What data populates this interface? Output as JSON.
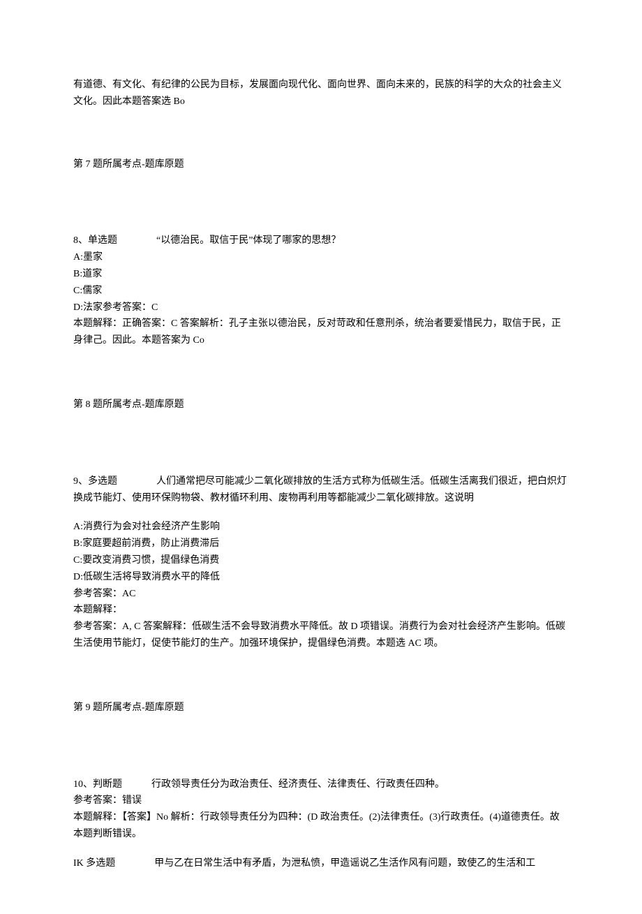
{
  "frag_top": "有道德、有文化、有纪律的公民为目标，发展面向现代化、面向世界、面向未来的，民族的科学的大众的社会主义文化。因此本题答案选 Bo",
  "q7_tag": "第 7 题所属考点-题库原题",
  "q8": {
    "head": "8、单选题　　　　“以德治民。取信于民”体现了哪家的思想？",
    "opt_a": "A:墨家",
    "opt_b": "B:道家",
    "opt_c": "C:儒家",
    "opt_d_ans": "D:法家参考答案：C",
    "explain": "本题解释：正确答案：C 答案解析：孔子主张以德治民，反对苛政和任意刑杀，统治者要爱惜民力，取信于民，正身律己。因此。本题答案为 Co"
  },
  "q8_tag": "第 8 题所属考点-题库原题",
  "q9": {
    "head": "9、多选题　　　　人们通常把尽可能减少二氧化碳排放的生活方式称为低碳生活。低碳生活离我们很近，把白炽灯换成节能灯、使用环保购物袋、教材循环利用、废物再利用等都能减少二氧化碳排放。这说明",
    "opt_a": "A:消费行为会对社会经济产生影响",
    "opt_b": "B:家庭要超前消费，防止消费滞后",
    "opt_c": "C:要改变消费习惯，提倡绿色消费",
    "opt_d": "D:低碳生活将导致消费水平的降低",
    "ans": "参考答案：AC",
    "exp_label": "本题解释：",
    "explain": "参考答案：A, C 答案解释：低碳生活不会导致消费水平降低。故 D 项错误。消费行为会对社会经济产生影响。低碳生活使用节能灯，促使节能灯的生产。加强环境保护，提倡绿色消费。本题选 AC 项。"
  },
  "q9_tag": "第 9 题所属考点-题库原题",
  "q10": {
    "head": "10、判断题　　　行政领导责任分为政治责任、经济责任、法律责任、行政责任四种。",
    "ans": "参考答案：错误",
    "explain": "本题解释：【答案】No 解析：行政领导责任分为四种：(D 政治责任。(2)法律责任。(3)行政责任。(4)道德责任。故本题判断错误。"
  },
  "q11": {
    "head": "IK 多选题　　　　甲与乙在日常生活中有矛盾，为泄私愤，甲造谣说乙生活作风有问题，致使乙的生活和工"
  }
}
